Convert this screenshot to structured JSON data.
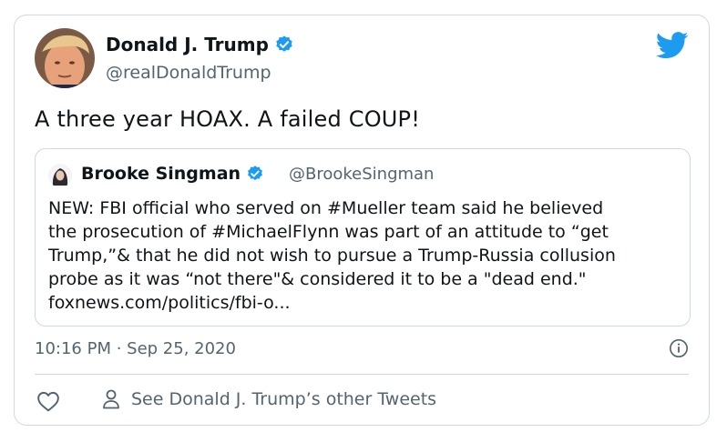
{
  "tweet": {
    "author": {
      "name": "Donald J. Trump",
      "handle": "@realDonaldTrump"
    },
    "text": "A three year HOAX. A failed COUP!",
    "timestamp": "10:16 PM · Sep 25, 2020",
    "other_tweets_label": "See Donald J. Trump’s other Tweets"
  },
  "quote": {
    "author": {
      "name": "Brooke Singman",
      "handle": "@BrookeSingman"
    },
    "lines": [
      "NEW: FBI official who served on #Mueller team said he believed",
      "the prosecution of #MichaelFlynn was part of an attitude to “get",
      "Trump,”& that he did not wish to pursue a Trump-Russia collusion",
      "probe as it was “not there\"& considered it to be a \"dead end.\"",
      "foxnews.com/politics/fbi-o..."
    ]
  },
  "icons": {
    "verified": "verified-badge-icon",
    "brand": "twitter-bird-icon",
    "info": "info-icon",
    "like": "heart-icon",
    "profile": "person-icon"
  },
  "colors": {
    "brand": "#1d9bf0",
    "text": "#0f1419",
    "secondary": "#536471",
    "border": "#cfd9de"
  }
}
